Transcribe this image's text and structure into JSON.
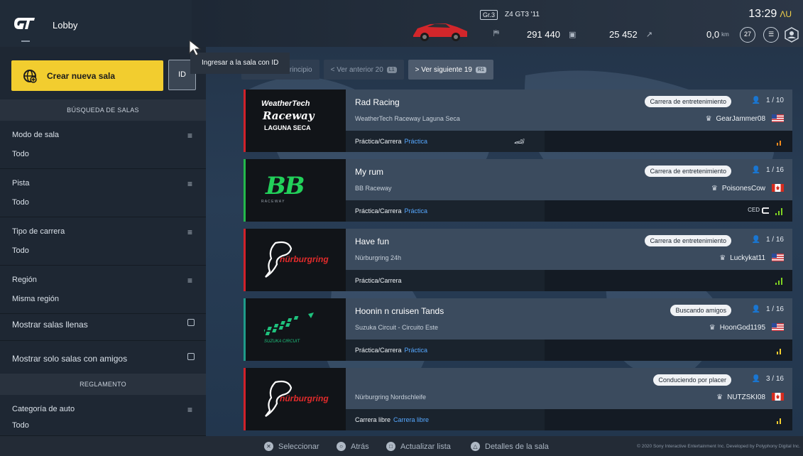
{
  "header": {
    "title": "Lobby",
    "car_class": "Gr.3",
    "car_name": "Z4 GT3 '11",
    "credits": "291 440",
    "mileage_points": "25 452",
    "distance": "0,0",
    "distance_unit": "km",
    "level": "27",
    "clock": "13:29",
    "clock_tail": "ΛU"
  },
  "sidebar": {
    "create_room_label": "Crear nueva sala",
    "id_button_label": "ID",
    "tooltip": "Ingresar a la sala con ID",
    "search_header": "BÚSQUEDA DE SALAS",
    "filters": [
      {
        "label": "Modo de sala",
        "value": "Todo"
      },
      {
        "label": "Pista",
        "value": "Todo"
      },
      {
        "label": "Tipo de carrera",
        "value": "Todo"
      },
      {
        "label": "Región",
        "value": "Misma región"
      }
    ],
    "toggles": [
      {
        "label": "Mostrar salas llenas"
      },
      {
        "label": "Mostrar solo salas con amigos"
      }
    ],
    "rules_header": "REGLAMENTO",
    "rules_filters": [
      {
        "label": "Categoría de auto",
        "value": "Todo"
      }
    ]
  },
  "nav": {
    "back_to_start": "|< Volver al principio",
    "prev": "< Ver anterior 20",
    "prev_key": "L1",
    "next": "> Ver siguiente 19",
    "next_key": "R1"
  },
  "rooms": [
    {
      "name": "Rad Racing",
      "track": "WeatherTech Raceway Laguna Seca",
      "badge": "Carrera de entretenimiento",
      "count": "1 / 10",
      "host": "GearJammer08",
      "flag": "us",
      "mode": "Práctica/Carrera",
      "mode_extra": "Práctica",
      "logo_text_1": "WeatherTech",
      "logo_text_2": "Raceway",
      "logo_text_3": "LAGUNA SECA",
      "accent": "#d0222a"
    },
    {
      "name": "My rum",
      "track": "BB Raceway",
      "badge": "Carrera de entretenimiento",
      "count": "1 / 16",
      "host": "PoisonesCow",
      "flag": "ca",
      "mode": "Práctica/Carrera",
      "mode_extra": "Práctica",
      "ced_label": "CED",
      "logo_text_1": "BB",
      "logo_text_2": "R A C E W A Y",
      "accent": "#23b84b"
    },
    {
      "name": "Have fun",
      "track": "Nürburgring 24h",
      "badge": "Carrera de entretenimiento",
      "count": "1 / 16",
      "host": "Luckykat11",
      "flag": "us",
      "mode": "Práctica/Carrera",
      "mode_extra": "",
      "logo_text_1": "nürburgring",
      "accent": "#d0222a"
    },
    {
      "name": "Hoonin n cruisen Tands",
      "track": "Suzuka Circuit - Circuito Este",
      "badge": "Buscando amigos",
      "count": "1 / 16",
      "host": "HoonGod1195",
      "flag": "us",
      "mode": "Práctica/Carrera",
      "mode_extra": "Práctica",
      "logo_text_1": "SUZUKA CIRCUIT",
      "accent": "#1f9b8a"
    },
    {
      "name": "",
      "track": "Nürburgring Nordschleife",
      "badge": "Conduciendo por placer",
      "count": "3 / 16",
      "host": "NUTZSKI08",
      "flag": "ca",
      "mode": "Carrera libre",
      "mode_extra": "Carrera libre",
      "logo_text_1": "nürburgring",
      "accent": "#d0222a"
    }
  ],
  "footer": {
    "select": "Seleccionar",
    "back": "Atrás",
    "refresh": "Actualizar lista",
    "details": "Detalles de la sala",
    "copyright": "© 2020 Sony Interactive Entertainment Inc. Developed by Polyphony Digital Inc."
  },
  "colors": {
    "accent_yellow": "#f2cd2f",
    "link_blue": "#56a8ff",
    "signal_green": "#7fd322",
    "signal_orange": "#f08a1c"
  }
}
